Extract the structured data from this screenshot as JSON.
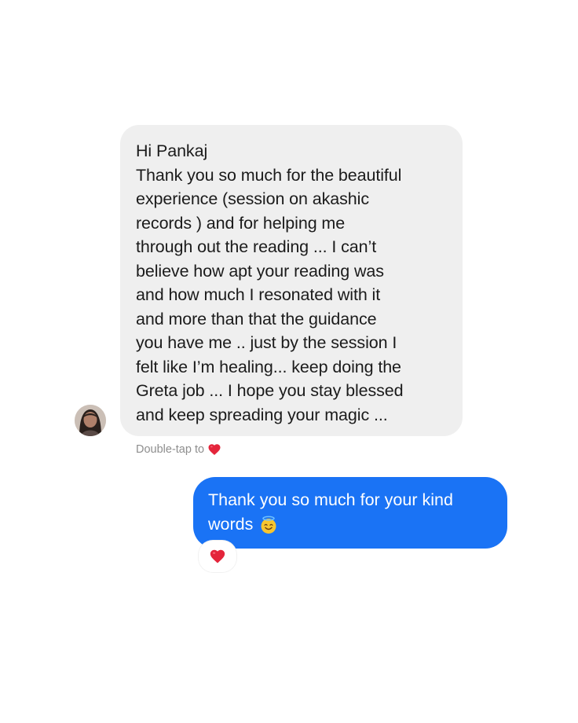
{
  "conversation": {
    "incoming_message": {
      "lines": [
        "Hi Pankaj",
        "Thank you so much for the beautiful",
        "experience (session on akashic",
        "records ) and for helping me",
        "through out the reading ... I can’t",
        "believe how apt your reading was",
        "and how much I resonated with it",
        "and more than that the guidance",
        "you have me .. just by the session I",
        "felt like I’m healing... keep doing the",
        "Greta job ... I hope you stay blessed",
        "and keep spreading your magic ..."
      ],
      "sender_avatar": "avatar-photo"
    },
    "double_tap_hint": {
      "text": "Double-tap to",
      "icon": "red-heart-icon"
    },
    "outgoing_message": {
      "lines": [
        "Thank you so much for your kind",
        "words"
      ],
      "emoji": "smiling-face-with-halo"
    },
    "reaction": {
      "icon": "red-heart-icon"
    }
  },
  "colors": {
    "incoming_bubble": "#efefef",
    "outgoing_bubble": "#1a73f5",
    "heart": "#e4253b",
    "hint_text": "#8e8e8e"
  }
}
